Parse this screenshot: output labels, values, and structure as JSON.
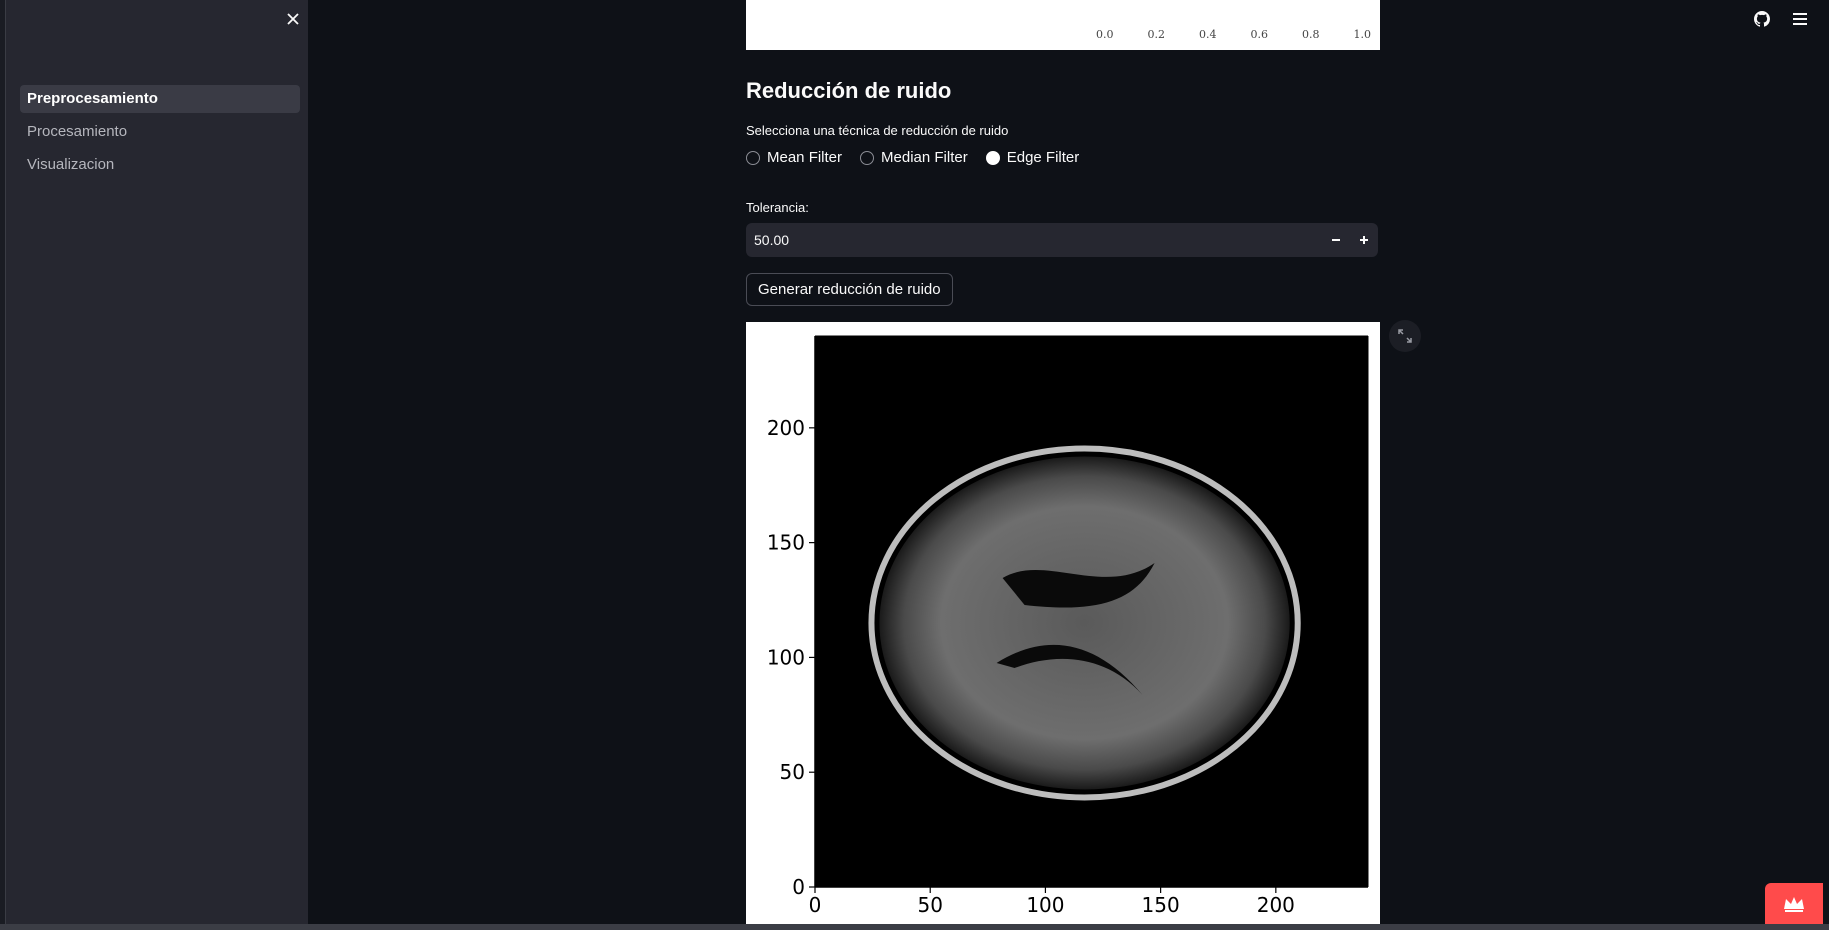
{
  "sidebar": {
    "items": [
      {
        "label": "Preprocesamiento",
        "active": true
      },
      {
        "label": "Procesamiento",
        "active": false
      },
      {
        "label": "Visualizacion",
        "active": false
      }
    ]
  },
  "header": {
    "icons": [
      "github-icon",
      "hamburger-menu-icon"
    ]
  },
  "previous_chart": {
    "x_ticks": [
      "0.0",
      "0.2",
      "0.4",
      "0.6",
      "0.8",
      "1.0"
    ]
  },
  "noise_reduction": {
    "title": "Reducción de ruido",
    "radio_label": "Selecciona una técnica de reducción de ruido",
    "options": [
      {
        "label": "Mean Filter",
        "checked": false
      },
      {
        "label": "Median Filter",
        "checked": false
      },
      {
        "label": "Edge Filter",
        "checked": true
      }
    ],
    "tolerance_label": "Tolerancia:",
    "tolerance_value": "50.00",
    "button_label": "Generar reducción de ruido"
  },
  "chart_data": {
    "type": "heatmap",
    "description_content": "grayscale axial brain MRI slice",
    "x_ticks": [
      0,
      50,
      100,
      150,
      200
    ],
    "y_ticks": [
      0,
      50,
      100,
      150,
      200
    ],
    "xlim": [
      0,
      240
    ],
    "ylim": [
      0,
      240
    ]
  },
  "colors": {
    "background": "#0e1117",
    "sidebar": "#262730",
    "accent": "#ff4b4b"
  }
}
